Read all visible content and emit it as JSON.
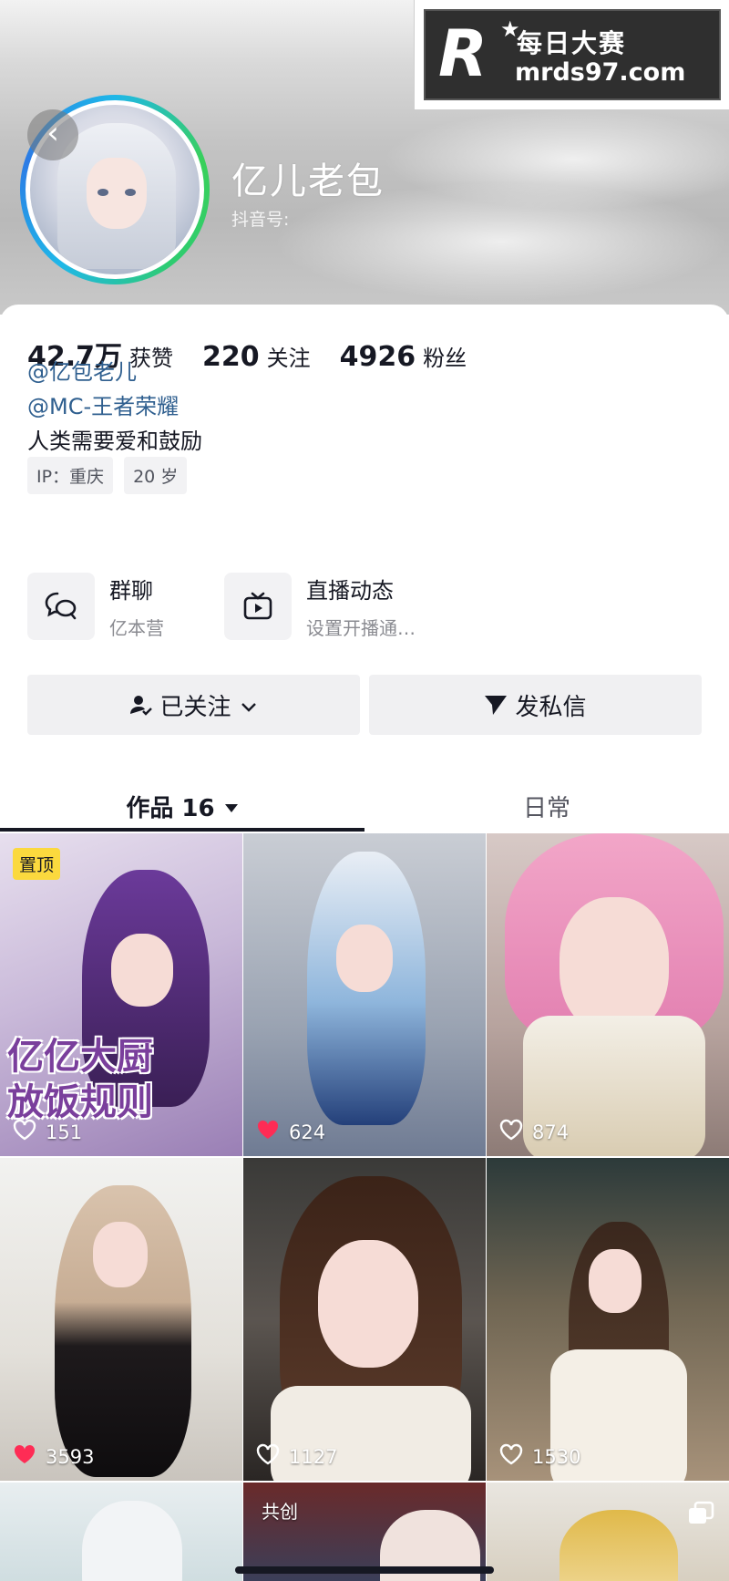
{
  "watermark": {
    "cn": "每日大赛",
    "url": "mrds97.com"
  },
  "profile": {
    "nickname": "亿儿老包",
    "douyin_id_label": "抖音号:",
    "back_glyph": "‹"
  },
  "stats": [
    {
      "num": "42.7万",
      "label": "获赞"
    },
    {
      "num": "220",
      "label": "关注"
    },
    {
      "num": "4926",
      "label": "粉丝"
    }
  ],
  "mentions": [
    "@亿包老儿",
    "@MC-王者荣耀"
  ],
  "bio": "人类需要爱和鼓励",
  "tags": [
    "IP：重庆",
    "20 岁"
  ],
  "features": [
    {
      "title": "群聊",
      "subtitle": "亿本营",
      "icon": "chat-bubbles-icon"
    },
    {
      "title": "直播动态",
      "subtitle": "设置开播通…",
      "icon": "tv-icon"
    }
  ],
  "buttons": {
    "followed": "已关注",
    "message": "发私信"
  },
  "tabs": {
    "works": "作品 16",
    "daily": "日常"
  },
  "grid": [
    {
      "likes": "151",
      "liked": false,
      "badge": "置顶",
      "overlay": "亿亿大厨\n放饭规则"
    },
    {
      "likes": "624",
      "liked": true
    },
    {
      "likes": "874",
      "liked": false
    },
    {
      "likes": "3593",
      "liked": true
    },
    {
      "likes": "1127",
      "liked": false
    },
    {
      "likes": "1530",
      "liked": false
    },
    {
      "collab": "共创"
    },
    {},
    {
      "multi": true
    }
  ],
  "colors": {
    "accent_like": "#fe2c55",
    "link": "#2f5f8f",
    "pin_bg": "#fbd93e"
  }
}
